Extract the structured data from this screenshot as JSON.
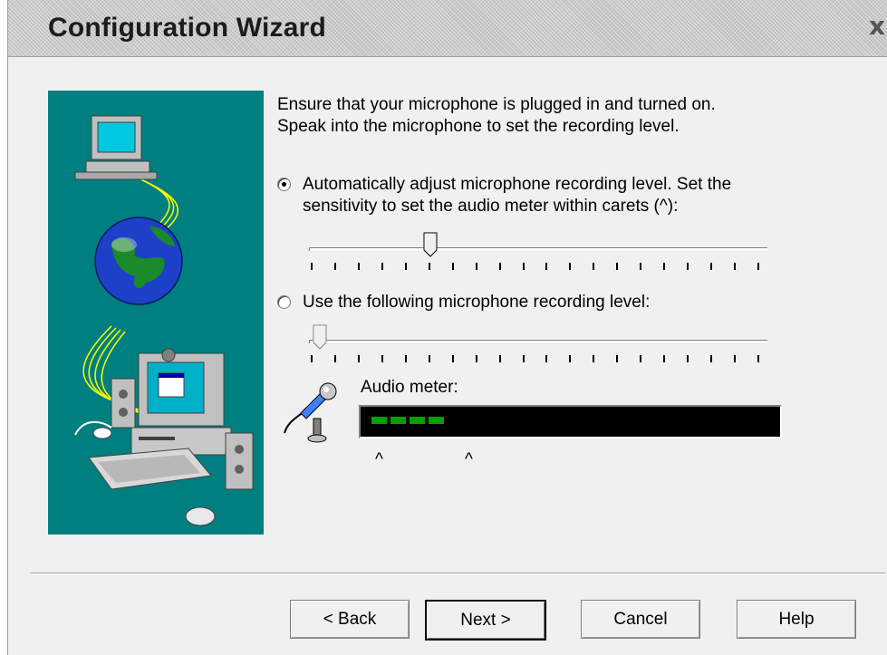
{
  "window": {
    "title": "Configuration Wizard",
    "close_glyph": "x"
  },
  "illustration": {
    "icons": [
      "computer-icon",
      "globe-icon",
      "desktop-computer-icon",
      "keyboard-icon",
      "mouse-icon",
      "speaker-icon",
      "webcam-icon"
    ],
    "background": "#007f80"
  },
  "intro": {
    "line1": "Ensure that your microphone is plugged in and turned on.",
    "line2": "Speak into the microphone to set the recording level."
  },
  "options": {
    "auto": {
      "line1": "Automatically adjust microphone recording level. Set the",
      "line2": "sensitivity to set the audio meter within carets (^):",
      "selected": true
    },
    "manual": {
      "line1": "Use the following microphone recording level:",
      "selected": false
    }
  },
  "sliders": {
    "sensitivity": {
      "value_fraction": 0.25,
      "tick_count": 20
    },
    "manual_level": {
      "value_fraction": 0.0,
      "tick_count": 20
    }
  },
  "audio_meter": {
    "label": "Audio meter:",
    "level_segments": 4,
    "segment_color": "#00a000",
    "carets": [
      "^",
      "^"
    ]
  },
  "buttons": {
    "back": "< Back",
    "next": "Next >",
    "cancel": "Cancel",
    "help": "Help"
  },
  "colors": {
    "accent": "#007f80",
    "meter_bg": "#000000"
  }
}
